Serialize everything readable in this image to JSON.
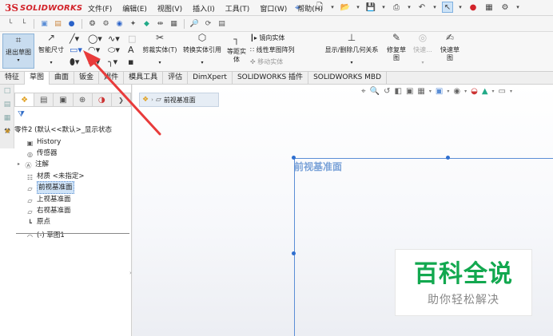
{
  "app": {
    "logo_ds": "3S",
    "logo_text": "SOLIDWORKS",
    "brand_color": "#d2232a"
  },
  "menu": [
    "文件(F)",
    "编辑(E)",
    "视图(V)",
    "插入(I)",
    "工具(T)",
    "窗口(W)",
    "帮助(H)"
  ],
  "ribbon": {
    "exit_sketch": "退出草图",
    "smart_dimension": "智能尺寸",
    "trim_entities": "剪裁实体(T)",
    "convert_entities": "转换实体引用",
    "offset_entities": "等距实体",
    "mirror_entities": "镜向实体",
    "linear_pattern": "线性草图阵列",
    "move_entities": "移动实体",
    "display_relations": "显示/删除几何关系",
    "repair_sketch": "修复草图",
    "quick_snaps": "快速...",
    "rapid_sketch": "快速草图"
  },
  "tabs": [
    "特征",
    "草图",
    "曲面",
    "钣金",
    "焊件",
    "模具工具",
    "评估",
    "DimXpert",
    "SOLIDWORKS 插件",
    "SOLIDWORKS MBD"
  ],
  "active_tab_index": 1,
  "tree": {
    "root": "零件2 (默认<<默认>_显示状态",
    "items": [
      {
        "label": "History",
        "icon": "history-icon"
      },
      {
        "label": "传感器",
        "icon": "sensor-icon"
      },
      {
        "label": "注解",
        "icon": "annotation-icon",
        "expandable": true
      },
      {
        "label": "材质 <未指定>",
        "icon": "material-icon"
      },
      {
        "label": "前视基准面",
        "icon": "plane-icon",
        "selected": true
      },
      {
        "label": "上视基准面",
        "icon": "plane-icon"
      },
      {
        "label": "右视基准面",
        "icon": "plane-icon"
      },
      {
        "label": "原点",
        "icon": "origin-icon"
      },
      {
        "label": "(-) 草图1",
        "icon": "sketch-icon"
      }
    ]
  },
  "graphics": {
    "breadcrumb": "前视基准面",
    "plane_label": "前视基准面",
    "plane_color": "#5b8ed6"
  },
  "watermark": {
    "title": "百科全说",
    "subtitle": "助你轻松解决",
    "color": "#12a84f"
  },
  "annotation": {
    "arrow_color": "#e83b3b"
  }
}
